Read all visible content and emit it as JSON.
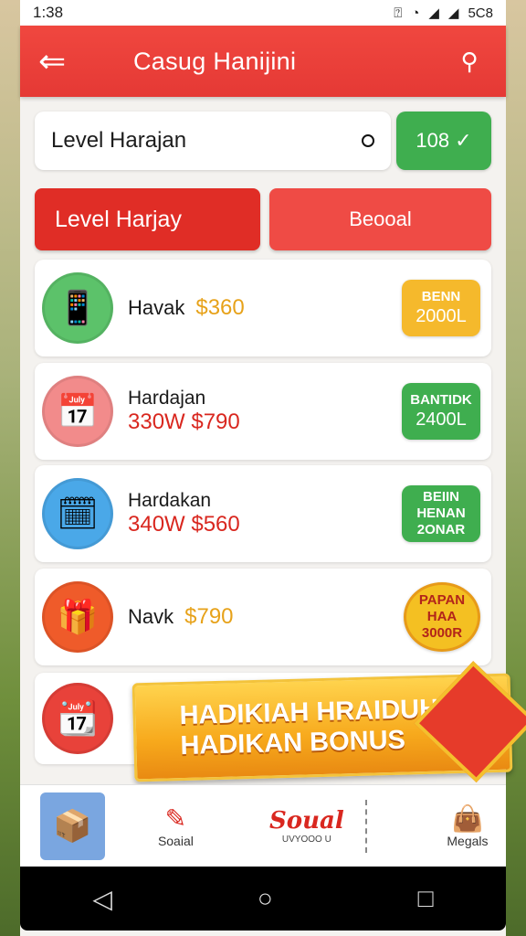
{
  "status_bar": {
    "time": "1:38",
    "right_text": "5C8"
  },
  "header": {
    "title": "Casug Hanijini"
  },
  "search": {
    "value": "Level Harajan",
    "button_label": "108 ✓"
  },
  "tabs": {
    "active_label": "Level Harjay",
    "other_label": "Beooal"
  },
  "items": [
    {
      "title": "Havak",
      "price": "$360",
      "badge_line1": "BENN",
      "badge_line2": "2000L"
    },
    {
      "title": "Hardajan",
      "price": "330W $790",
      "badge_line1": "BANTIDK",
      "badge_line2": "2400L"
    },
    {
      "title": "Hardakan",
      "price": "340W $560",
      "badge_line1": "BEIIN",
      "badge_line2": "HENAN",
      "badge_line3": "2ONAR"
    },
    {
      "title": "Navk",
      "price": "$790",
      "badge_line1": "PAPAN",
      "badge_line2": "HAA",
      "badge_line3": "3000R"
    }
  ],
  "promo": {
    "line1": "HADIKIAH HRAIDUH",
    "line2": "HADIKAN BONUS"
  },
  "bottom_nav": {
    "social_label": "Soaial",
    "brand_label": "Soual",
    "brand_sub": "UVYOOO U",
    "megals_label": "Megals"
  },
  "colors": {
    "primary": "#e53935",
    "green": "#3fae4f",
    "gold": "#f5b92c"
  }
}
